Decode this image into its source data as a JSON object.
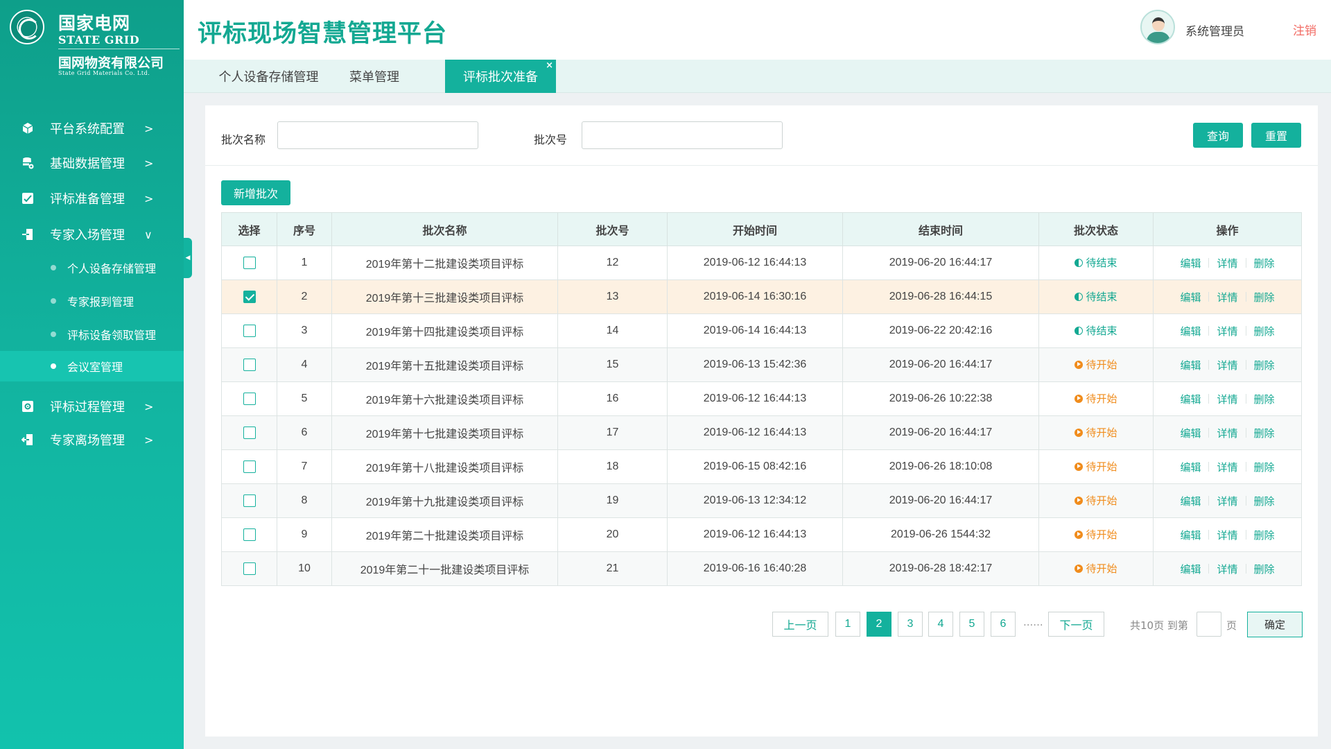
{
  "brand": {
    "cn": "国家电网",
    "en": "STATE GRID",
    "company": "国网物资有限公司",
    "company_en": "State Grid Materials Co. Ltd."
  },
  "header": {
    "title": "评标现场智慧管理平台",
    "user": "系统管理员",
    "logout": "注销"
  },
  "sidebar": {
    "items": [
      {
        "label": "平台系统配置",
        "icon": "cube-icon",
        "arrow": ">"
      },
      {
        "label": "基础数据管理",
        "icon": "database-settings-icon",
        "arrow": ">"
      },
      {
        "label": "评标准备管理",
        "icon": "edit-note-icon",
        "arrow": ">"
      },
      {
        "label": "专家入场管理",
        "icon": "enter-door-icon",
        "arrow": "∨"
      },
      {
        "label": "评标过程管理",
        "icon": "gear-box-icon",
        "arrow": ">"
      },
      {
        "label": "专家离场管理",
        "icon": "exit-door-icon",
        "arrow": ">"
      }
    ],
    "subitems": [
      {
        "label": "个人设备存储管理"
      },
      {
        "label": "专家报到管理"
      },
      {
        "label": "评标设备领取管理"
      },
      {
        "label": "会议室管理",
        "active": true
      }
    ]
  },
  "tabs": [
    {
      "label": "个人设备存储管理"
    },
    {
      "label": "菜单管理"
    },
    {
      "label": "评标批次准备",
      "active": true,
      "close": "×"
    }
  ],
  "filters": {
    "batch_name_label": "批次名称",
    "batch_name_value": "",
    "batch_no_label": "批次号",
    "batch_no_value": "",
    "query": "查询",
    "reset": "重置"
  },
  "add_button": "新增批次",
  "table": {
    "columns": [
      "选择",
      "序号",
      "批次名称",
      "批次号",
      "开始时间",
      "结束时间",
      "批次状态",
      "操作"
    ],
    "actions": [
      "编辑",
      "详情",
      "删除"
    ],
    "rows": [
      {
        "checked": false,
        "no": "1",
        "name": "2019年第十二批建设类项目评标",
        "batch": "12",
        "start": "2019-06-12 16:44:13",
        "end": "2019-06-20 16:44:17",
        "status": "待结束",
        "status_type": "ending"
      },
      {
        "checked": true,
        "no": "2",
        "name": "2019年第十三批建设类项目评标",
        "batch": "13",
        "start": "2019-06-14 16:30:16",
        "end": "2019-06-28 16:44:15",
        "status": "待结束",
        "status_type": "ending"
      },
      {
        "checked": false,
        "no": "3",
        "name": "2019年第十四批建设类项目评标",
        "batch": "14",
        "start": "2019-06-14 16:44:13",
        "end": "2019-06-22 20:42:16",
        "status": "待结束",
        "status_type": "ending"
      },
      {
        "checked": false,
        "no": "4",
        "name": "2019年第十五批建设类项目评标",
        "batch": "15",
        "start": "2019-06-13 15:42:36",
        "end": "2019-06-20 16:44:17",
        "status": "待开始",
        "status_type": "pending"
      },
      {
        "checked": false,
        "no": "5",
        "name": "2019年第十六批建设类项目评标",
        "batch": "16",
        "start": "2019-06-12 16:44:13",
        "end": "2019-06-26 10:22:38",
        "status": "待开始",
        "status_type": "pending"
      },
      {
        "checked": false,
        "no": "6",
        "name": "2019年第十七批建设类项目评标",
        "batch": "17",
        "start": "2019-06-12 16:44:13",
        "end": "2019-06-20 16:44:17",
        "status": "待开始",
        "status_type": "pending"
      },
      {
        "checked": false,
        "no": "7",
        "name": "2019年第十八批建设类项目评标",
        "batch": "18",
        "start": "2019-06-15 08:42:16",
        "end": "2019-06-26 18:10:08",
        "status": "待开始",
        "status_type": "pending"
      },
      {
        "checked": false,
        "no": "8",
        "name": "2019年第十九批建设类项目评标",
        "batch": "19",
        "start": "2019-06-13 12:34:12",
        "end": "2019-06-20 16:44:17",
        "status": "待开始",
        "status_type": "pending"
      },
      {
        "checked": false,
        "no": "9",
        "name": "2019年第二十批建设类项目评标",
        "batch": "20",
        "start": "2019-06-12 16:44:13",
        "end": "2019-06-26 1544:32",
        "status": "待开始",
        "status_type": "pending"
      },
      {
        "checked": false,
        "no": "10",
        "name": "2019年第二十一批建设类项目评标",
        "batch": "21",
        "start": "2019-06-16 16:40:28",
        "end": "2019-06-28 18:42:17",
        "status": "待开始",
        "status_type": "pending"
      }
    ]
  },
  "pagination": {
    "prev": "上一页",
    "next": "下一页",
    "pages": [
      "1",
      "2",
      "3",
      "4",
      "5",
      "6"
    ],
    "current": "2",
    "ellipsis": "......",
    "total_text": "共10页 到第",
    "page_unit": "页",
    "jump_value": "",
    "confirm": "确定"
  },
  "colors": {
    "primary": "#14b19d",
    "pending": "#f08c1c",
    "logout": "#f26b64",
    "selected_row": "#fdf1e2"
  }
}
